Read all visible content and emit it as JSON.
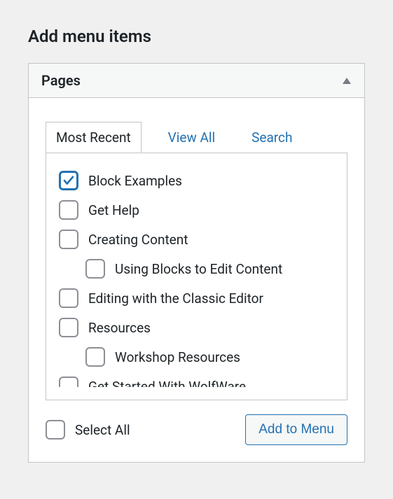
{
  "sectionTitle": "Add menu items",
  "panel": {
    "title": "Pages"
  },
  "tabs": {
    "mostRecent": "Most Recent",
    "viewAll": "View All",
    "search": "Search"
  },
  "items": [
    {
      "label": "Block Examples",
      "checked": true,
      "depth": 0
    },
    {
      "label": "Get Help",
      "checked": false,
      "depth": 0
    },
    {
      "label": "Creating Content",
      "checked": false,
      "depth": 0
    },
    {
      "label": "Using Blocks to Edit Content",
      "checked": false,
      "depth": 1
    },
    {
      "label": "Editing with the Classic Editor",
      "checked": false,
      "depth": 0
    },
    {
      "label": "Resources",
      "checked": false,
      "depth": 0
    },
    {
      "label": "Workshop Resources",
      "checked": false,
      "depth": 1
    },
    {
      "label": "Get Started With WolfWare",
      "checked": false,
      "depth": 0
    }
  ],
  "footer": {
    "selectAll": "Select All",
    "addButton": "Add to Menu"
  }
}
